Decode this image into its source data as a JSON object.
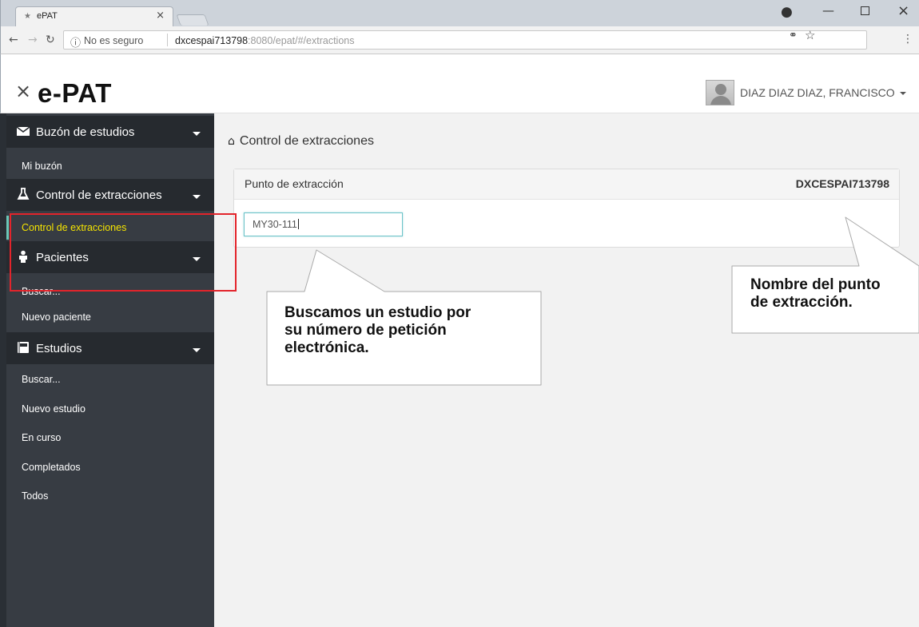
{
  "browser": {
    "tab_title": "ePAT",
    "insecure_label": "No es seguro",
    "url_host": "dxcespai713798",
    "url_rest": ":8080/epat/#/extractions"
  },
  "header": {
    "brand": "e-PAT",
    "user_name": "DIAZ DIAZ DIAZ, FRANCISCO"
  },
  "sidebar": {
    "sections": [
      {
        "label": "Buzón de estudios",
        "icon": "envelope-icon",
        "items": [
          "Mi buzón"
        ]
      },
      {
        "label": "Control de extracciones",
        "icon": "flask-icon",
        "items": [
          "Control de extracciones"
        ]
      },
      {
        "label": "Pacientes",
        "icon": "user-icon",
        "items": [
          "Buscar...",
          "Nuevo paciente"
        ]
      },
      {
        "label": "Estudios",
        "icon": "book-icon",
        "items": [
          "Buscar...",
          "Nuevo estudio",
          "En curso",
          "Completados",
          "Todos"
        ]
      }
    ],
    "active_item": "Control de extracciones"
  },
  "main": {
    "breadcrumb": "Control de extracciones",
    "panel_title": "Punto de extracción",
    "panel_value": "DXCESPAI713798",
    "search_value": "MY30-111"
  },
  "annotations": {
    "search_callout": [
      "Buscamos un estudio por",
      "su número de petición",
      "electrónica."
    ],
    "name_callout": [
      "Nombre del punto",
      "de extracción."
    ]
  },
  "colors": {
    "sidebar_bg": "#373c43",
    "sidebar_header_bg": "#262a2f",
    "active_item": "#f5e400",
    "highlight_border": "#e3242b",
    "input_border": "#6cc3c8"
  }
}
